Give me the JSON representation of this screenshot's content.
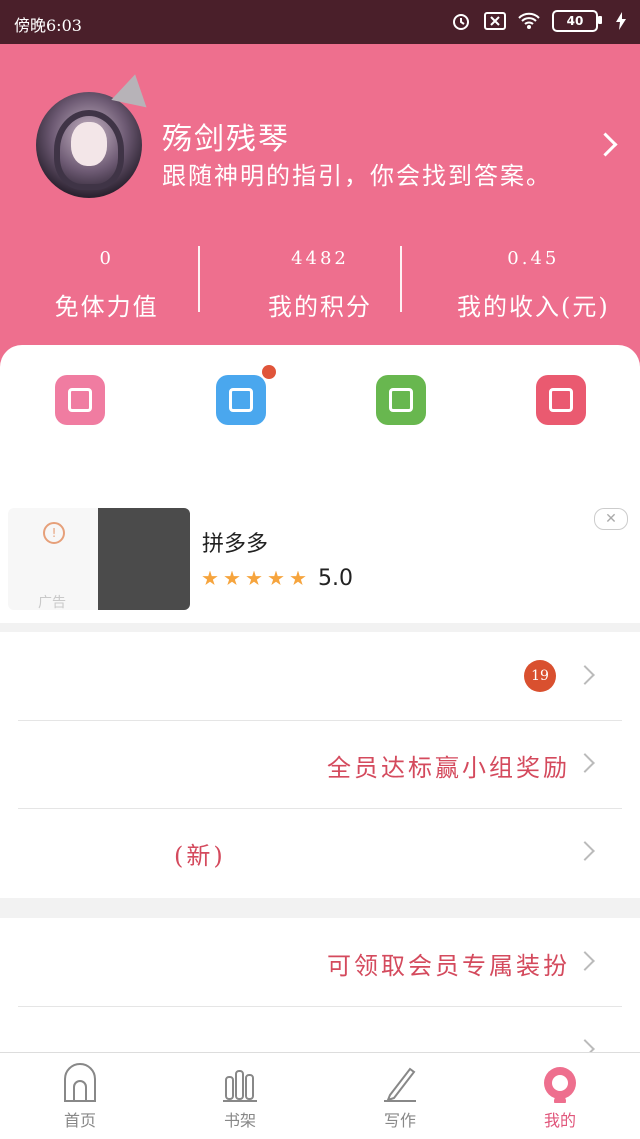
{
  "status_bar": {
    "time": "傍晚6:03",
    "battery": "40"
  },
  "profile": {
    "username": "殇剑残琴",
    "signature": "跟随神明的指引，你会找到答案。"
  },
  "stats": [
    {
      "value": "0",
      "label": "免体力值"
    },
    {
      "value": "4482",
      "label": "我的积分"
    },
    {
      "value": "0.45",
      "label": "我的收入(元)"
    }
  ],
  "colors": {
    "header": "#ee6f8e",
    "quick_1": "#f07ca1",
    "quick_2": "#4aa7ee",
    "quick_3": "#68b74f",
    "quick_4": "#ea5a70"
  },
  "quick_icons": [
    "heart-envelope-icon",
    "notepad-icon",
    "document-icon",
    "gift-icon"
  ],
  "ad": {
    "title": "拼多多",
    "rating": "5.0",
    "tag": "广告",
    "stars": 5
  },
  "list1": [
    {
      "text": "",
      "badge": "19"
    },
    {
      "text": "全员达标赢小组奖励"
    },
    {
      "text": "(新)"
    }
  ],
  "list2": [
    {
      "text": "可领取会员专属装扮"
    }
  ],
  "tabs": [
    {
      "label": "首页"
    },
    {
      "label": "书架"
    },
    {
      "label": "写作"
    },
    {
      "label": "我的"
    }
  ]
}
